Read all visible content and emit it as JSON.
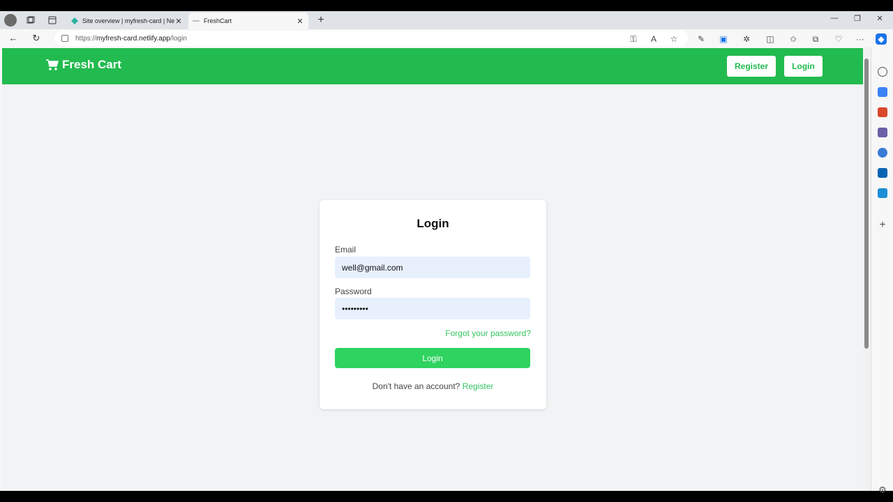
{
  "browser": {
    "tabs": [
      {
        "title": "Site overview | myfresh-card | Net",
        "active": false
      },
      {
        "title": "FreshCart",
        "active": true
      }
    ],
    "url_prefix": "https://",
    "url_host": "myfresh-card.netlify.app",
    "url_path": "/login",
    "accent": "#1a73e8"
  },
  "navbar": {
    "brand": "Fresh Cart",
    "register_label": "Register",
    "login_label": "Login",
    "color": "#22bb4f"
  },
  "login": {
    "heading": "Login",
    "email_label": "Email",
    "email_value": "well@gmail.com",
    "password_label": "Password",
    "password_value": "•••••••••",
    "forgot_link": "Forgot your password?",
    "submit_label": "Login",
    "no_account_text": "Don't have an account?",
    "register_link": "Register"
  }
}
